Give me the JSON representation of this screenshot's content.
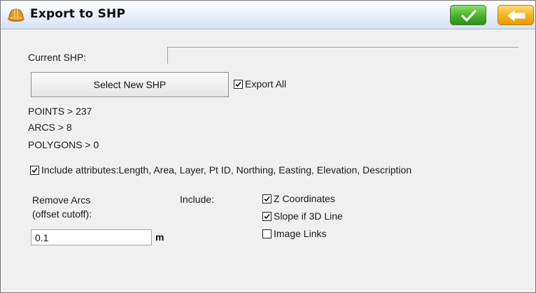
{
  "window": {
    "title": "Export to SHP",
    "app_icon": "hard-hat-icon",
    "ok_icon": "checkmark-icon",
    "back_icon": "back-arrow-icon",
    "ok_color": "#45b22a",
    "back_color": "#f6b21c"
  },
  "form": {
    "current_shp_label": "Current SHP:",
    "current_shp_value": "",
    "select_button_label": "Select New SHP",
    "export_all": {
      "label": "Export All",
      "checked": true
    },
    "stats": {
      "points": "POINTS > 237",
      "arcs": "ARCS > 8",
      "polygons": "POLYGONS > 0"
    },
    "include_attributes": {
      "label": "Include attributes:Length, Area, Layer, Pt ID, Northing, Easting, Elevation, Description",
      "checked": true
    },
    "remove_arcs_label_line1": "Remove Arcs",
    "remove_arcs_label_line2": "(offset cutoff):",
    "offset_value": "0.1",
    "offset_unit": "m",
    "include_label": "Include:",
    "include_options": [
      {
        "label": "Z Coordinates",
        "checked": true
      },
      {
        "label": "Slope if 3D Line",
        "checked": true
      },
      {
        "label": "Image Links",
        "checked": false
      }
    ]
  }
}
